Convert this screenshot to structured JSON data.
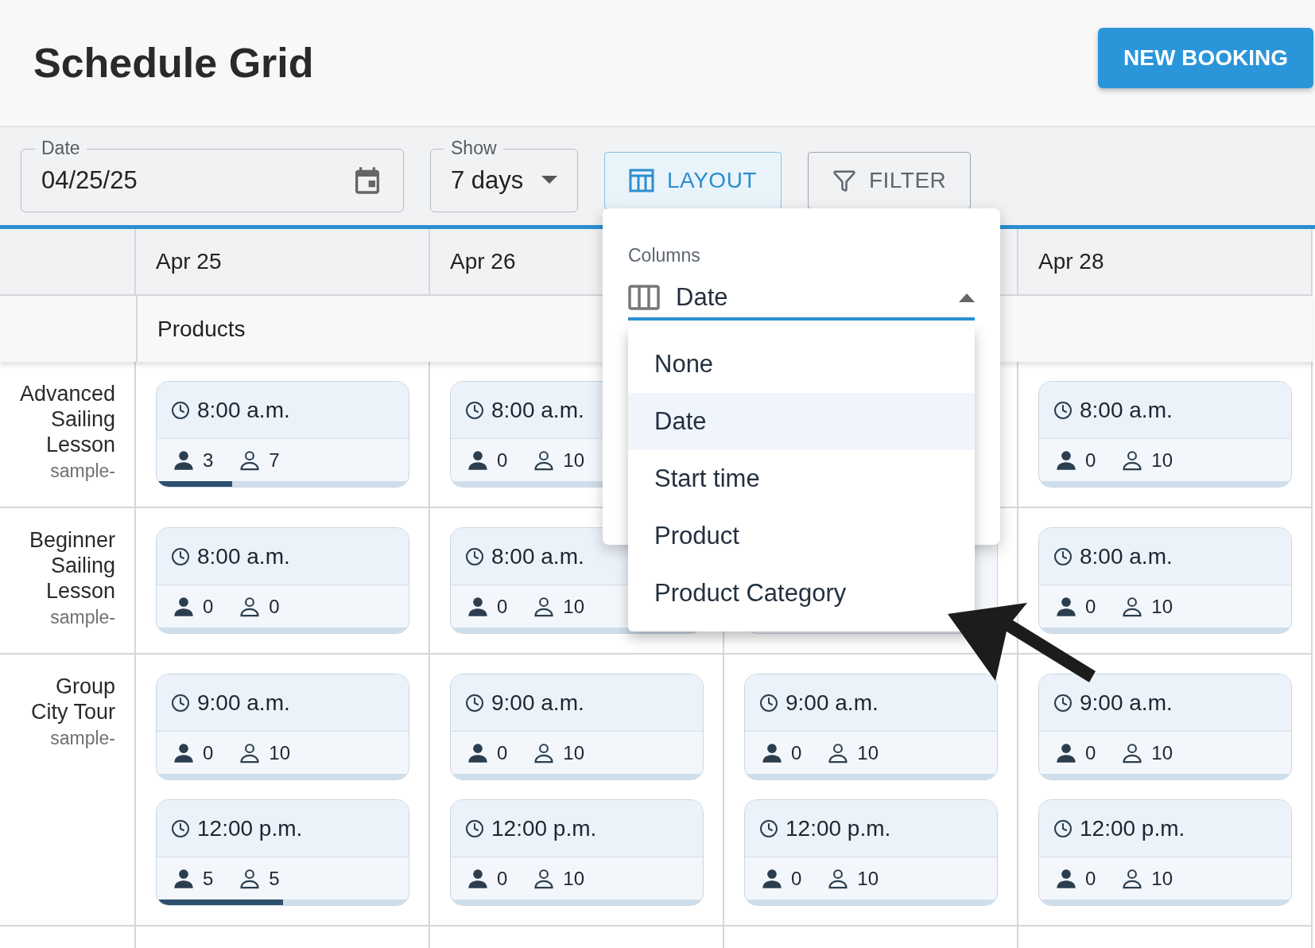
{
  "header": {
    "title": "Schedule Grid",
    "new_booking_button": "NEW BOOKING"
  },
  "toolbar": {
    "date_field": {
      "label": "Date",
      "value": "04/25/25"
    },
    "show_select": {
      "label": "Show",
      "value": "7 days"
    },
    "layout_button": {
      "label": "LAYOUT",
      "selected": true
    },
    "filter_button": {
      "label": "FILTER",
      "selected": false
    }
  },
  "grid": {
    "columns": [
      {
        "kind": "date",
        "label": "Apr 25"
      },
      {
        "kind": "date",
        "label": "Apr 26"
      },
      {
        "kind": "covered"
      },
      {
        "kind": "date",
        "label": "Apr 28"
      }
    ],
    "group_label": "Products",
    "rows": [
      {
        "name": "Advanced Sailing Lesson",
        "code": "sample-",
        "cells": [
          [
            {
              "kind": "session",
              "time": "8:00 a.m.",
              "booked": "3",
              "available": "7",
              "level": 0.3
            }
          ],
          [
            {
              "kind": "session",
              "time": "8:00 a.m.",
              "booked": "0",
              "available": "10",
              "level": 0
            }
          ],
          [],
          [
            {
              "kind": "session",
              "time": "8:00 a.m.",
              "booked": "0",
              "available": "10",
              "level": 0
            }
          ]
        ]
      },
      {
        "name": "Beginner Sailing Lesson",
        "code": "sample-",
        "cells": [
          [
            {
              "kind": "session",
              "time": "8:00 a.m.",
              "booked": "0",
              "available": "0",
              "level": 0
            }
          ],
          [
            {
              "kind": "session",
              "time": "8:00 a.m.",
              "booked": "0",
              "available": "10",
              "level": 0
            }
          ],
          [
            {
              "kind": "covered"
            }
          ],
          [
            {
              "kind": "session",
              "time": "8:00 a.m.",
              "booked": "0",
              "available": "10",
              "level": 0
            }
          ]
        ]
      },
      {
        "name": "Group City Tour",
        "code": "sample-",
        "cells": [
          [
            {
              "kind": "session",
              "time": "9:00 a.m.",
              "booked": "0",
              "available": "10",
              "level": 0
            },
            {
              "kind": "session",
              "time": "12:00 p.m.",
              "booked": "5",
              "available": "5",
              "level": 0.5
            }
          ],
          [
            {
              "kind": "session",
              "time": "9:00 a.m.",
              "booked": "0",
              "available": "10",
              "level": 0
            },
            {
              "kind": "session",
              "time": "12:00 p.m.",
              "booked": "0",
              "available": "10",
              "level": 0
            }
          ],
          [
            {
              "kind": "session",
              "time": "9:00 a.m.",
              "booked": "0",
              "available": "10",
              "level": 0
            },
            {
              "kind": "session",
              "time": "12:00 p.m.",
              "booked": "0",
              "available": "10",
              "level": 0
            }
          ],
          [
            {
              "kind": "session",
              "time": "9:00 a.m.",
              "booked": "0",
              "available": "10",
              "level": 0
            },
            {
              "kind": "session",
              "time": "12:00 p.m.",
              "booked": "0",
              "available": "10",
              "level": 0
            }
          ]
        ]
      }
    ]
  },
  "layout_popover": {
    "label": "Columns",
    "value": "Date",
    "expanded": true,
    "options": [
      {
        "label": "None",
        "selected": false
      },
      {
        "label": "Date",
        "selected": true
      },
      {
        "label": "Start time",
        "selected": false
      },
      {
        "label": "Product",
        "selected": false
      },
      {
        "label": "Product Category",
        "selected": false
      }
    ]
  }
}
